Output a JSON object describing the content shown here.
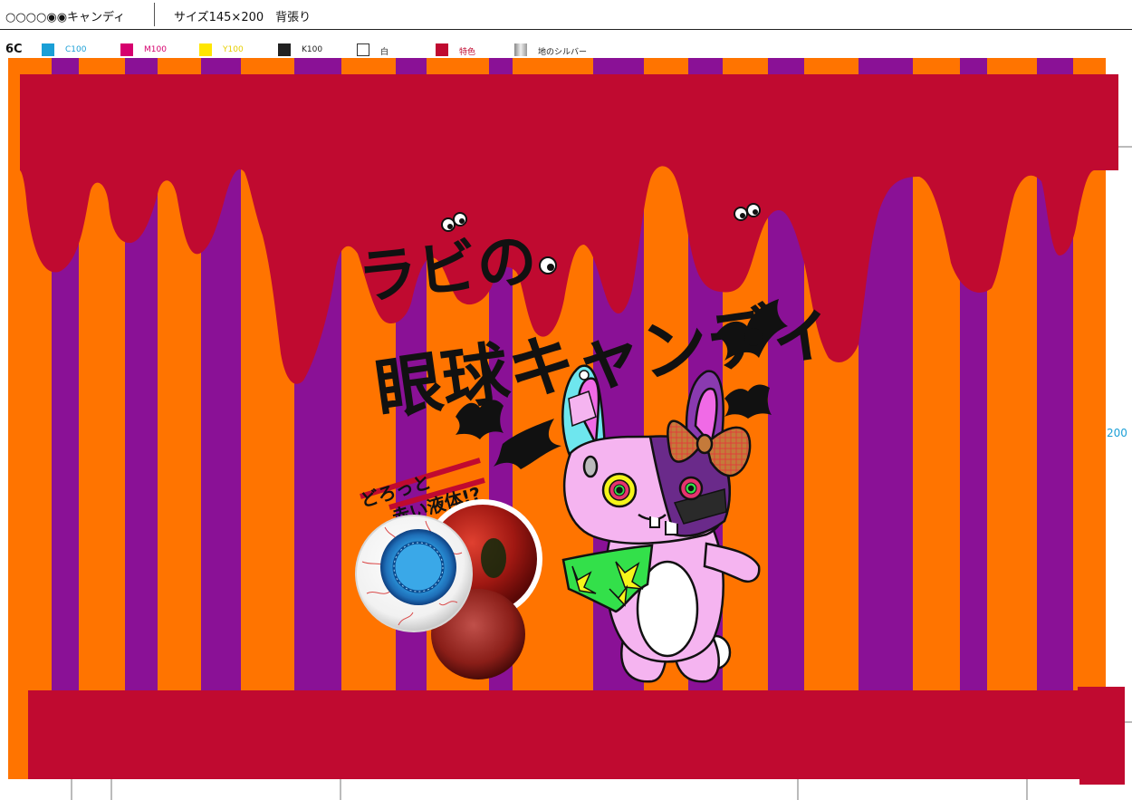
{
  "header": {
    "title": "○○○○◉◉キャンディ",
    "size_info": "サイズ145×200　背張り"
  },
  "legend": {
    "code": "6C",
    "items": [
      {
        "label": "C100",
        "color": "#1a9fd6",
        "text_color": "#1a9fd6"
      },
      {
        "label": "M100",
        "color": "#d6006e",
        "text_color": "#d6006e"
      },
      {
        "label": "Y100",
        "color": "#ffe600",
        "text_color": "#e6cf00"
      },
      {
        "label": "K100",
        "color": "#222222",
        "text_color": "#222222"
      },
      {
        "label": "白",
        "color": "#ffffff",
        "text_color": "#222222"
      },
      {
        "label": "特色",
        "color": "#c00a30",
        "text_color": "#c00a30"
      },
      {
        "label": "地のシルバー",
        "color": "#bbbbbb",
        "text_color": "#222222"
      }
    ]
  },
  "artwork": {
    "title_line1": "ラビの",
    "title_line2": "眼球キャンディ",
    "tagline_line1": "どろっと",
    "tagline_line2": "赤い液体!?",
    "colors": {
      "orange": "#ff7400",
      "purple": "#8a1196",
      "red": "#c00a30",
      "rabbit_pink": "#f5b4f0",
      "iris_blue": "#2fa3e6"
    }
  },
  "dimension_label": "200"
}
